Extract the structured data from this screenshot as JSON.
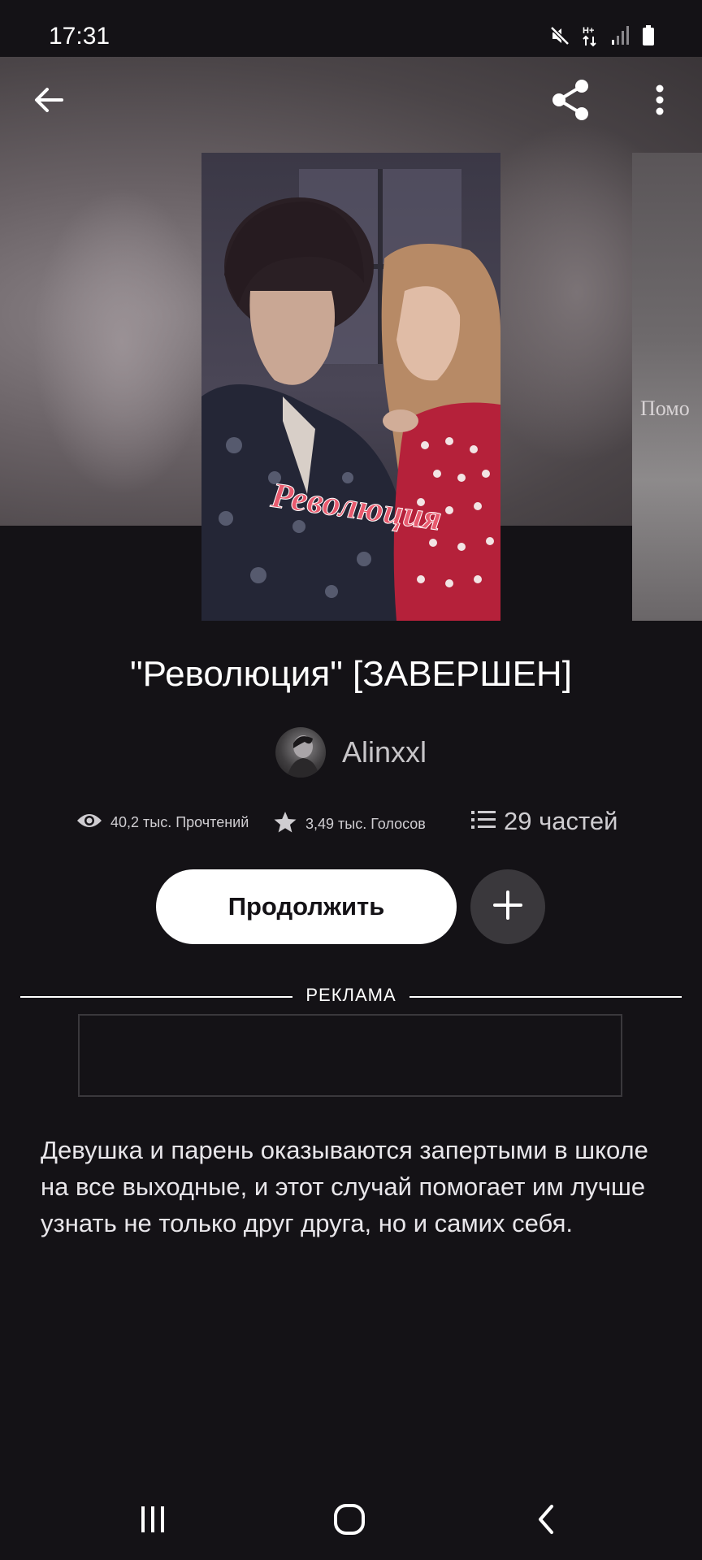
{
  "status_bar": {
    "time": "17:31",
    "icons": [
      "mute-icon",
      "data-arrows-icon",
      "signal-icon",
      "battery-icon"
    ]
  },
  "top_bar": {
    "icons": [
      "back-arrow-icon",
      "share-icon",
      "more-vertical-icon"
    ]
  },
  "story": {
    "title": "\"Революция\" [ЗАВЕРШЕН]",
    "cover_text": "Революция",
    "next_cover_text": "Помо",
    "author": "Alinxxl",
    "stats": {
      "reads": "40,2 тыс. Прочтений",
      "votes": "3,49 тыс. Голосов",
      "parts": "29 частей"
    },
    "continue_label": "Продолжить",
    "description": "Девушка и парень оказываются запертыми в школе на все выходные, и этот случай помогает им лучше узнать не только друг друга, но и самих себя."
  },
  "ad": {
    "label": "РЕКЛАМА"
  },
  "nav_bar": {
    "icons": [
      "recent-apps-icon",
      "home-icon",
      "back-icon"
    ]
  },
  "colors": {
    "background": "#141216",
    "button_primary": "#ffffff",
    "button_secondary": "#3a383c",
    "cover_title": "#e85a6e"
  }
}
